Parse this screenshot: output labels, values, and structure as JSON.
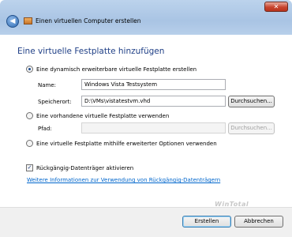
{
  "window": {
    "title": "Einen virtuellen Computer erstellen",
    "close_glyph": "✕",
    "back_glyph": "◀"
  },
  "heading": "Eine virtuelle Festplatte hinzufügen",
  "option_dynamic": {
    "label": "Eine dynamisch erweiterbare virtuelle Festplatte erstellen",
    "checked": true
  },
  "name_field": {
    "label": "Name:",
    "value": "Windows Vista Testsystem"
  },
  "location_field": {
    "label": "Speicherort:",
    "value": "D:\\VMs\\vistatestvm.vhd"
  },
  "browse_button": "Durchsuchen...",
  "option_existing": {
    "label": "Eine vorhandene virtuelle Festplatte verwenden",
    "checked": false
  },
  "path_field": {
    "label": "Pfad:",
    "value": ""
  },
  "browse_button_disabled": "Durchsuchen...",
  "option_advanced": {
    "label": "Eine virtuelle Festplatte mithilfe erweiterter Optionen verwenden",
    "checked": false
  },
  "undo_disk": {
    "label": "Rückgängig-Datenträger aktivieren",
    "checked": true
  },
  "info_link": "Weitere Informationen zur Verwendung von Rückgängig-Datenträgern",
  "buttons": {
    "create": "Erstellen",
    "cancel": "Abbrechen"
  },
  "watermark": "WinTotal"
}
